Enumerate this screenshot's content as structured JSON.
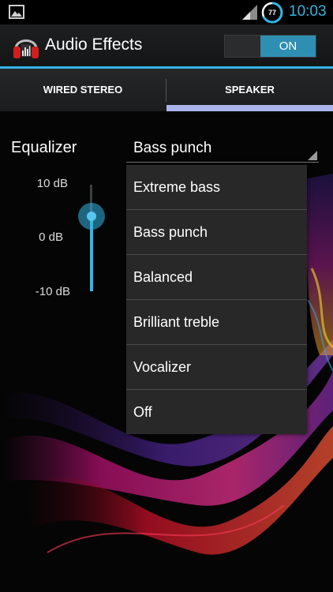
{
  "status_bar": {
    "icons": [
      "gallery-icon",
      "signal-icon",
      "battery-icon"
    ],
    "battery_level": "77",
    "time": "10:03"
  },
  "action_bar": {
    "app_icon": "headphones-equalizer-icon",
    "title": "Audio Effects",
    "toggle_label": "ON"
  },
  "tabs": [
    {
      "label": "WIRED STEREO",
      "selected": false
    },
    {
      "label": "SPEAKER",
      "selected": true
    }
  ],
  "equalizer": {
    "label": "Equalizer",
    "selected_preset": "Bass punch",
    "db_labels": {
      "top": "10 dB",
      "mid": "0 dB",
      "bottom": "-10 dB"
    },
    "band_level_db": 0
  },
  "dropdown": {
    "options": [
      "Extreme bass",
      "Bass punch",
      "Balanced",
      "Brilliant treble",
      "Vocalizer",
      "Off"
    ]
  },
  "colors": {
    "accent": "#33b5e5",
    "tab_indicator": "#aab4ea",
    "toggle_on": "#2e8fb3",
    "dropdown_bg": "#282828"
  }
}
